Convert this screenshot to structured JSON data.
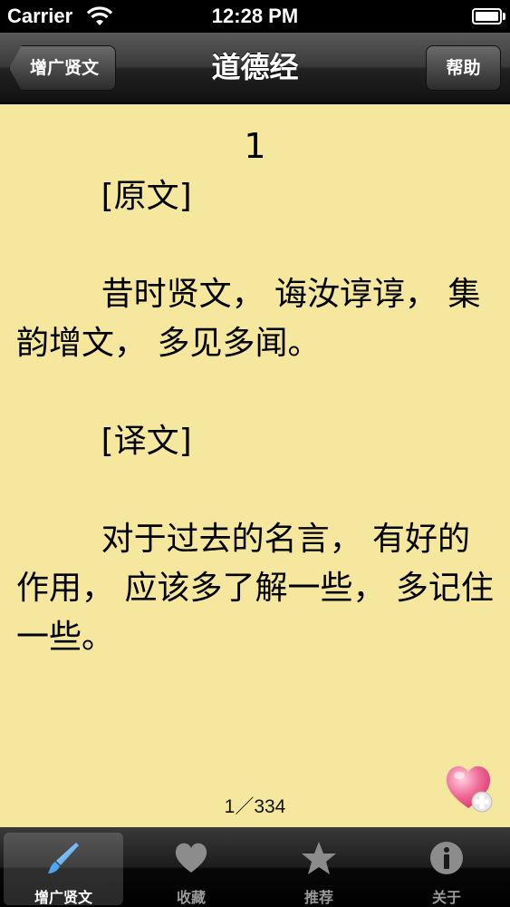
{
  "status_bar": {
    "carrier": "Carrier",
    "time": "12:28 PM",
    "battery_level": 1.0
  },
  "nav": {
    "title": "道德经",
    "back_label": "增广贤文",
    "help_label": "帮助"
  },
  "content": {
    "chapter_number": "1",
    "original_heading": "[原文]",
    "original_text": "昔时贤文， 诲汝谆谆， 集韵增文， 多见多闻。",
    "translation_heading": "[译文]",
    "translation_text": "对于过去的名言， 有好的作用， 应该多了解一些， 多记住一些。",
    "page_indicator": "1／334",
    "background_color": "#f5e79e"
  },
  "tabs": [
    {
      "label": "增广贤文",
      "icon": "brush-icon",
      "active": true
    },
    {
      "label": "收藏",
      "icon": "heart-icon",
      "active": false
    },
    {
      "label": "推荐",
      "icon": "star-icon",
      "active": false
    },
    {
      "label": "关于",
      "icon": "info-icon",
      "active": false
    }
  ]
}
